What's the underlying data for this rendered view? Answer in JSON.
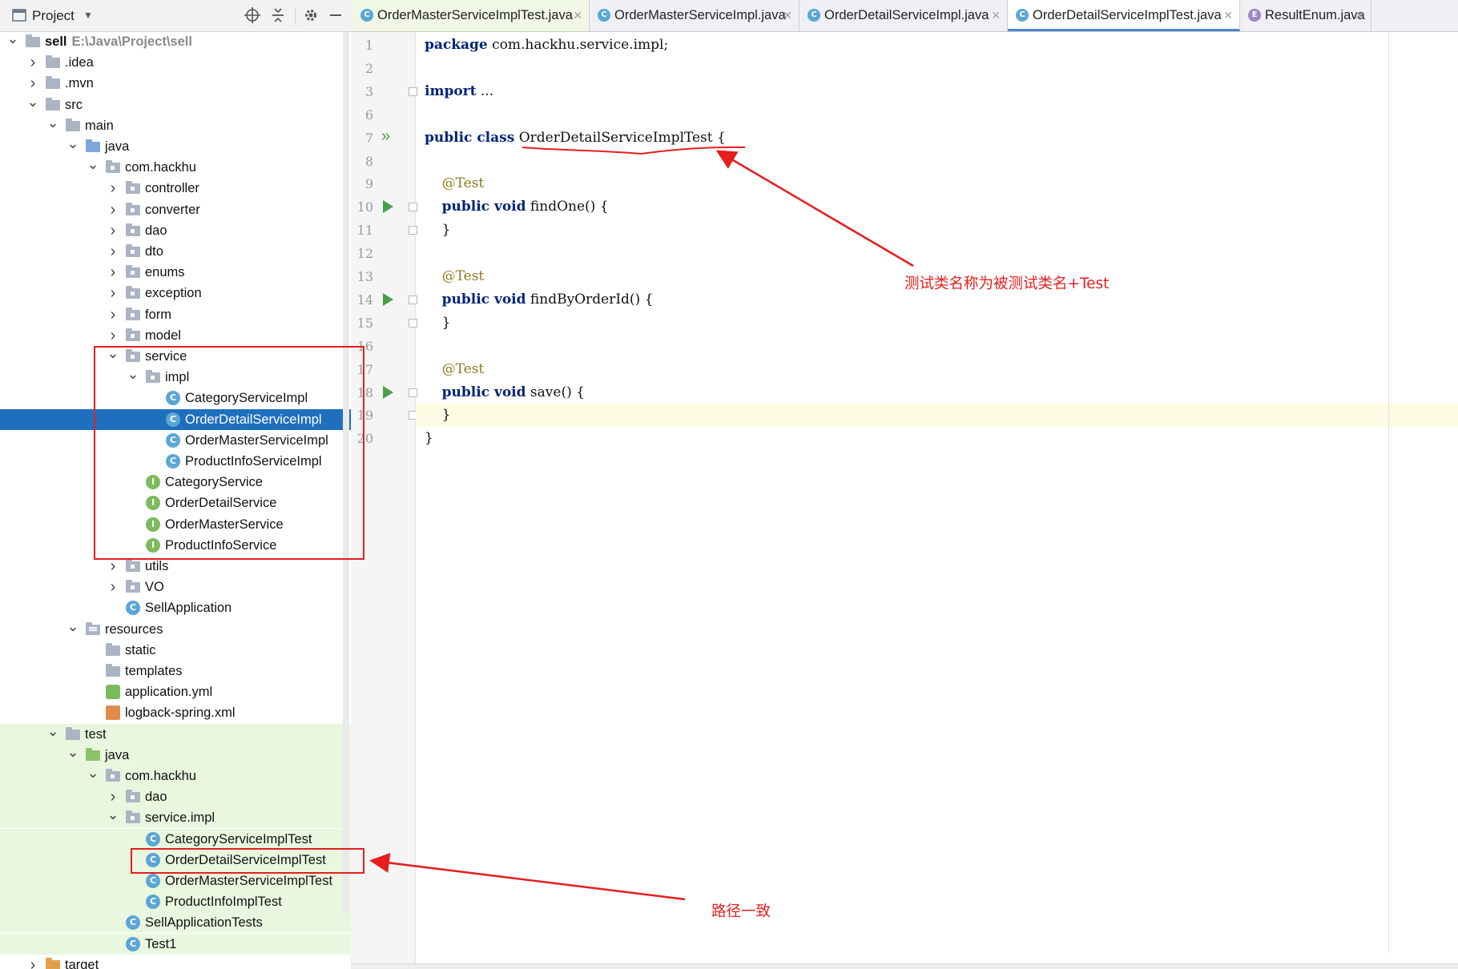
{
  "panel": {
    "title": "Project"
  },
  "tabs": [
    {
      "label": "OrderMasterServiceImplTest.java",
      "icon": "C",
      "state": "modified"
    },
    {
      "label": "OrderMasterServiceImpl.java",
      "icon": "C",
      "state": "normal"
    },
    {
      "label": "OrderDetailServiceImpl.java",
      "icon": "C",
      "state": "normal"
    },
    {
      "label": "OrderDetailServiceImplTest.java",
      "icon": "C",
      "state": "active"
    },
    {
      "label": "ResultEnum.java",
      "icon": "E",
      "state": "normal"
    }
  ],
  "tree": [
    {
      "label": "sell",
      "hint": "E:\\Java\\Project\\sell",
      "icon": "folder-module",
      "arrow": "down",
      "depth": 0,
      "bold": true
    },
    {
      "label": ".idea",
      "icon": "folder",
      "arrow": "right",
      "depth": 1
    },
    {
      "label": ".mvn",
      "icon": "folder",
      "arrow": "right",
      "depth": 1
    },
    {
      "label": "src",
      "icon": "folder",
      "arrow": "down",
      "depth": 1
    },
    {
      "label": "main",
      "icon": "folder",
      "arrow": "down",
      "depth": 2
    },
    {
      "label": "java",
      "icon": "folder-src",
      "arrow": "down",
      "depth": 3
    },
    {
      "label": "com.hackhu",
      "icon": "package",
      "arrow": "down",
      "depth": 4
    },
    {
      "label": "controller",
      "icon": "package",
      "arrow": "right",
      "depth": 5
    },
    {
      "label": "converter",
      "icon": "package",
      "arrow": "right",
      "depth": 5
    },
    {
      "label": "dao",
      "icon": "package",
      "arrow": "right",
      "depth": 5
    },
    {
      "label": "dto",
      "icon": "package",
      "arrow": "right",
      "depth": 5
    },
    {
      "label": "enums",
      "icon": "package",
      "arrow": "right",
      "depth": 5
    },
    {
      "label": "exception",
      "icon": "package",
      "arrow": "right",
      "depth": 5
    },
    {
      "label": "form",
      "icon": "package",
      "arrow": "right",
      "depth": 5
    },
    {
      "label": "model",
      "icon": "package",
      "arrow": "right",
      "depth": 5
    },
    {
      "label": "service",
      "icon": "package",
      "arrow": "down",
      "depth": 5
    },
    {
      "label": "impl",
      "icon": "package",
      "arrow": "down",
      "depth": 6
    },
    {
      "label": "CategoryServiceImpl",
      "icon": "class",
      "arrow": "",
      "depth": 7
    },
    {
      "label": "OrderDetailServiceImpl",
      "icon": "class",
      "arrow": "",
      "depth": 7,
      "selected": true
    },
    {
      "label": "OrderMasterServiceImpl",
      "icon": "class",
      "arrow": "",
      "depth": 7
    },
    {
      "label": "ProductInfoServiceImpl",
      "icon": "class",
      "arrow": "",
      "depth": 7
    },
    {
      "label": "CategoryService",
      "icon": "interface",
      "arrow": "",
      "depth": 6
    },
    {
      "label": "OrderDetailService",
      "icon": "interface",
      "arrow": "",
      "depth": 6
    },
    {
      "label": "OrderMasterService",
      "icon": "interface",
      "arrow": "",
      "depth": 6
    },
    {
      "label": "ProductInfoService",
      "icon": "interface",
      "arrow": "",
      "depth": 6
    },
    {
      "label": "utils",
      "icon": "package",
      "arrow": "right",
      "depth": 5
    },
    {
      "label": "VO",
      "icon": "package",
      "arrow": "right",
      "depth": 5
    },
    {
      "label": "SellApplication",
      "icon": "spring-class",
      "arrow": "",
      "depth": 5
    },
    {
      "label": "resources",
      "icon": "folder-res",
      "arrow": "down",
      "depth": 3
    },
    {
      "label": "static",
      "icon": "folder",
      "arrow": "",
      "depth": 4
    },
    {
      "label": "templates",
      "icon": "folder",
      "arrow": "",
      "depth": 4
    },
    {
      "label": "application.yml",
      "icon": "yml",
      "arrow": "",
      "depth": 4
    },
    {
      "label": "logback-spring.xml",
      "icon": "xml",
      "arrow": "",
      "depth": 4
    },
    {
      "label": "test",
      "icon": "folder",
      "arrow": "down",
      "depth": 2,
      "test": true
    },
    {
      "label": "java",
      "icon": "folder-green",
      "arrow": "down",
      "depth": 3,
      "test": true
    },
    {
      "label": "com.hackhu",
      "icon": "package",
      "arrow": "down",
      "depth": 4,
      "test": true
    },
    {
      "label": "dao",
      "icon": "package",
      "arrow": "right",
      "depth": 5,
      "test": true
    },
    {
      "label": "service.impl",
      "icon": "package",
      "arrow": "down",
      "depth": 5,
      "test": true
    },
    {
      "label": "CategoryServiceImplTest",
      "icon": "test-class",
      "arrow": "",
      "depth": 6,
      "test": true
    },
    {
      "label": "OrderDetailServiceImplTest",
      "icon": "test-class",
      "arrow": "",
      "depth": 6,
      "test": true
    },
    {
      "label": "OrderMasterServiceImplTest",
      "icon": "test-class",
      "arrow": "",
      "depth": 6,
      "test": true
    },
    {
      "label": "ProductInfoImplTest",
      "icon": "test-class",
      "arrow": "",
      "depth": 6,
      "test": true
    },
    {
      "label": "SellApplicationTests",
      "icon": "test-class",
      "arrow": "",
      "depth": 5,
      "test": true
    },
    {
      "label": "Test1",
      "icon": "test-class",
      "arrow": "",
      "depth": 5,
      "test": true
    },
    {
      "label": "target",
      "icon": "folder-orange",
      "arrow": "right",
      "depth": 1
    }
  ],
  "editor": {
    "lines": [
      {
        "no": "1",
        "tokens": [
          [
            "kw",
            "package"
          ],
          [
            "t",
            " com.hackhu.service.impl;"
          ]
        ]
      },
      {
        "no": "2",
        "tokens": []
      },
      {
        "no": "3",
        "tokens": [
          [
            "kw",
            "import"
          ],
          [
            "t",
            " ..."
          ]
        ],
        "fold": true
      },
      {
        "no": "6",
        "tokens": []
      },
      {
        "no": "7",
        "tokens": [
          [
            "kw",
            "public class"
          ],
          [
            "t",
            " OrderDetailServiceImplTest {"
          ]
        ],
        "run": "double"
      },
      {
        "no": "8",
        "tokens": []
      },
      {
        "no": "9",
        "tokens": [
          [
            "t",
            "    "
          ],
          [
            "ann",
            "@Test"
          ]
        ]
      },
      {
        "no": "10",
        "tokens": [
          [
            "t",
            "    "
          ],
          [
            "kw",
            "public void"
          ],
          [
            "t",
            " findOne() {"
          ]
        ],
        "run": "single",
        "fold": true
      },
      {
        "no": "11",
        "tokens": [
          [
            "t",
            "    }"
          ]
        ],
        "fold": true
      },
      {
        "no": "12",
        "tokens": []
      },
      {
        "no": "13",
        "tokens": [
          [
            "t",
            "    "
          ],
          [
            "ann",
            "@Test"
          ]
        ]
      },
      {
        "no": "14",
        "tokens": [
          [
            "t",
            "    "
          ],
          [
            "kw",
            "public void"
          ],
          [
            "t",
            " findByOrderId() {"
          ]
        ],
        "run": "single",
        "fold": true
      },
      {
        "no": "15",
        "tokens": [
          [
            "t",
            "    }"
          ]
        ],
        "fold": true
      },
      {
        "no": "16",
        "tokens": []
      },
      {
        "no": "17",
        "tokens": [
          [
            "t",
            "    "
          ],
          [
            "ann",
            "@Test"
          ]
        ]
      },
      {
        "no": "18",
        "tokens": [
          [
            "t",
            "    "
          ],
          [
            "kw",
            "public void"
          ],
          [
            "t",
            " save() {"
          ]
        ],
        "run": "single",
        "fold": true
      },
      {
        "no": "19",
        "tokens": [
          [
            "t",
            "    }"
          ]
        ],
        "fold": true,
        "current": true
      },
      {
        "no": "20",
        "tokens": [
          [
            "t",
            "}"
          ]
        ]
      }
    ]
  },
  "annotations": {
    "class_note": "测试类名称为被测试类名+Test",
    "path_note": "路径一致",
    "color": "#e61e1e"
  },
  "colors": {
    "selection": "#1f6fbf",
    "test_bg": "#e9f7df",
    "keyword": "#00237a",
    "annotation": "#8a7a1d"
  }
}
